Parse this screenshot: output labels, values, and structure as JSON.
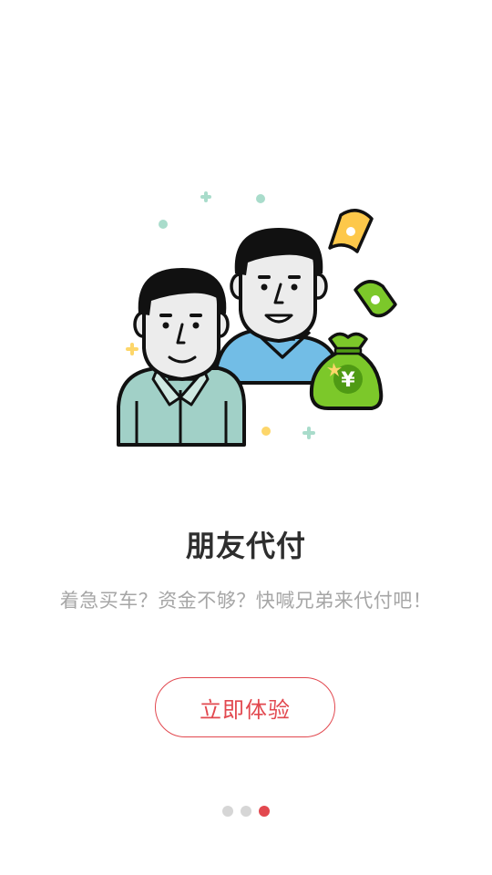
{
  "page": {
    "title": "朋友代付",
    "subtitle": "着急买车？资金不够？快喊兄弟来代付吧！",
    "cta_label": "立即体验"
  },
  "illustration": {
    "icons": [
      "friends-illustration",
      "money-bag-icon",
      "banknote-icon"
    ],
    "money_symbol": "¥"
  },
  "pagination": {
    "total": 3,
    "current": 3,
    "active_color": "#e2484f",
    "inactive_color": "#d6d6d6"
  },
  "colors": {
    "accent": "#e2484f",
    "title": "#2e2e2e",
    "subtitle": "#a6a6a6"
  }
}
